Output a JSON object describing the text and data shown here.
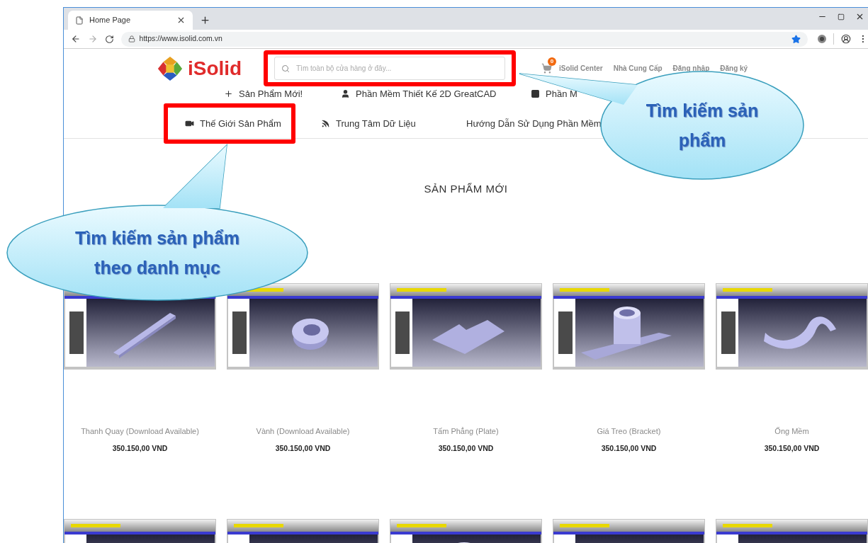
{
  "browser": {
    "tab": {
      "title": "Home Page"
    },
    "url": "https://www.isolid.com.vn",
    "bookmarked": true
  },
  "header": {
    "logo": "iSolid",
    "search": {
      "placeholder": "Tìm toàn bộ cửa hàng ở đây...",
      "highlighted": true
    },
    "cart_count": "0",
    "links": [
      "iSolid Center",
      "Nhà Cung Cấp",
      "Đăng nhập",
      "Đăng ký"
    ]
  },
  "nav_rows": [
    [
      {
        "label": "Sản Phẩm Mới!",
        "highlighted": false
      },
      {
        "label": "Phần Mềm Thiết Kế 2D GreatCAD",
        "highlighted": false
      },
      {
        "label": "Phần M",
        "highlighted": false
      }
    ],
    [
      {
        "label": "Thế Giới Sản Phẩm",
        "highlighted": true
      },
      {
        "label": "Trung Tâm Dữ Liệu",
        "highlighted": false
      },
      {
        "label": "Hướng Dẫn Sử Dụng Phần Mềm",
        "highlighted": false
      }
    ]
  ],
  "section_title": "SẢN PHẨM MỚI",
  "products": [
    {
      "name": "Thanh Quay (Download Available)",
      "price": "350.150,00 VND"
    },
    {
      "name": "Vành (Download Available)",
      "price": "350.150,00 VND"
    },
    {
      "name": "Tấm Phẳng (Plate)",
      "price": "350.150,00 VND"
    },
    {
      "name": "Giá Treo (Bracket)",
      "price": "350.150,00 VND"
    },
    {
      "name": "Ống Mềm",
      "price": "350.150,00 VND"
    }
  ],
  "products_row_2": [
    {
      "kind": "picture"
    },
    {
      "kind": "picture"
    },
    {
      "kind": "picture"
    },
    {
      "kind": "picture"
    },
    {
      "kind": "picture"
    }
  ],
  "callouts": [
    {
      "text": "Tìm kiếm sản phẩm"
    },
    {
      "text": "Tìm kiếm sản phẩm theo danh mục"
    }
  ]
}
